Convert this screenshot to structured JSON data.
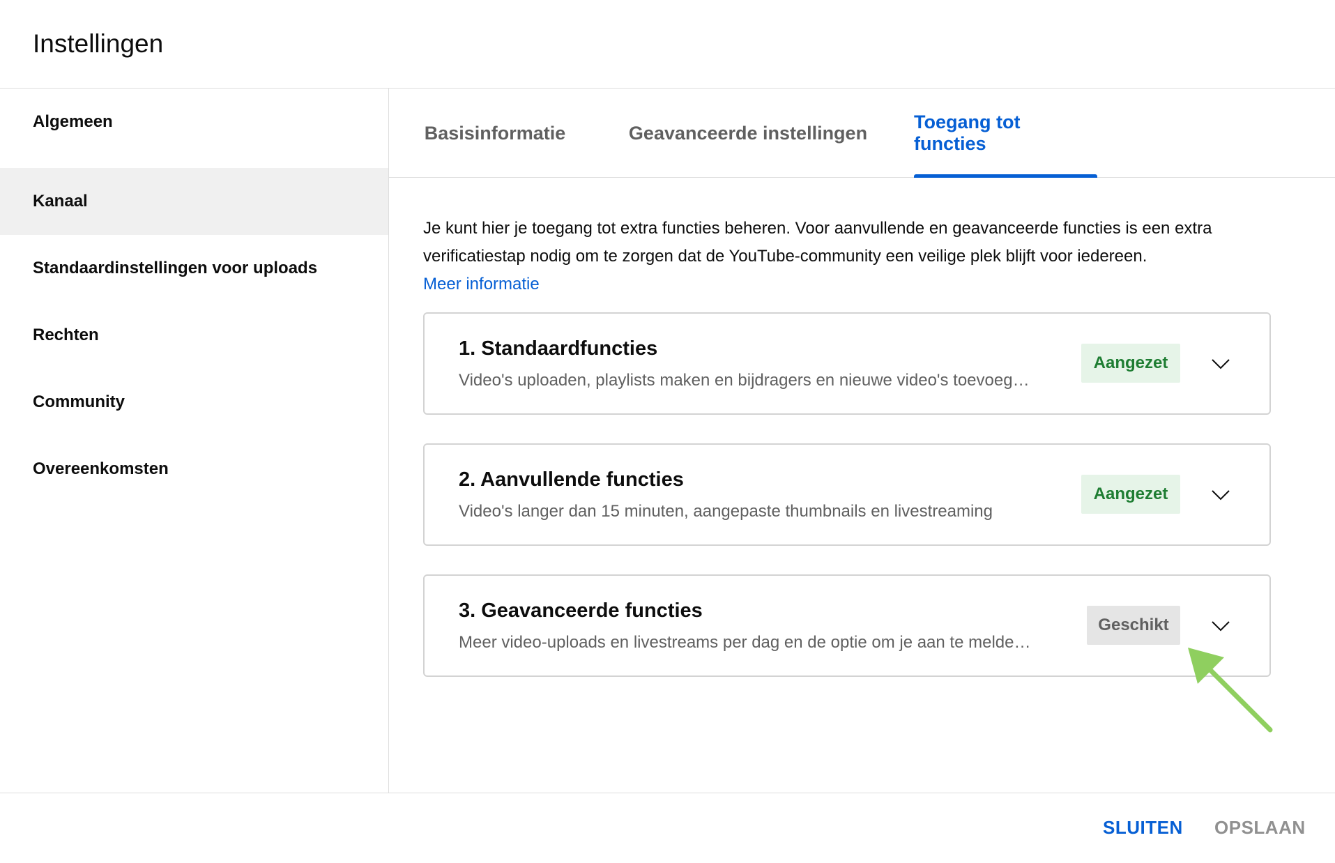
{
  "header": {
    "title": "Instellingen"
  },
  "sidebar": {
    "items": [
      {
        "label": "Algemeen"
      },
      {
        "label": "Kanaal"
      },
      {
        "label": "Standaardinstellingen voor uploads"
      },
      {
        "label": "Rechten"
      },
      {
        "label": "Community"
      },
      {
        "label": "Overeenkomsten"
      }
    ],
    "active": "Kanaal"
  },
  "tabs": {
    "items": [
      {
        "label": "Basisinformatie"
      },
      {
        "label": "Geavanceerde instellingen"
      },
      {
        "label": "Toegang tot functies"
      }
    ],
    "active": "Toegang tot functies"
  },
  "intro": {
    "text": "Je kunt hier je toegang tot extra functies beheren. Voor aanvullende en geavanceerde functies is een extra verificatiestap nodig om te zorgen dat de YouTube-community een veilige plek blijft voor iedereen.",
    "link": "Meer informatie"
  },
  "features": [
    {
      "title": "1. Standaardfuncties",
      "description": "Video's uploaden, playlists maken en bijdragers en nieuwe video's toevoeg…",
      "status": "Aangezet",
      "status_color": "#1e7d32"
    },
    {
      "title": "2. Aanvullende functies",
      "description": "Video's langer dan 15 minuten, aangepaste thumbnails en livestreaming",
      "status": "Aangezet",
      "status_color": "#1e7d32"
    },
    {
      "title": "3. Geavanceerde functies",
      "description": "Meer video-uploads en livestreams per dag en de optie om je aan te melde…",
      "status": "Geschikt",
      "status_color": "#606060"
    }
  ],
  "footer": {
    "close_label": "SLUITEN",
    "save_label": "OPSLAAN"
  },
  "colors": {
    "accent": "#065fd4",
    "annotation_arrow": "#8fcf5f"
  }
}
